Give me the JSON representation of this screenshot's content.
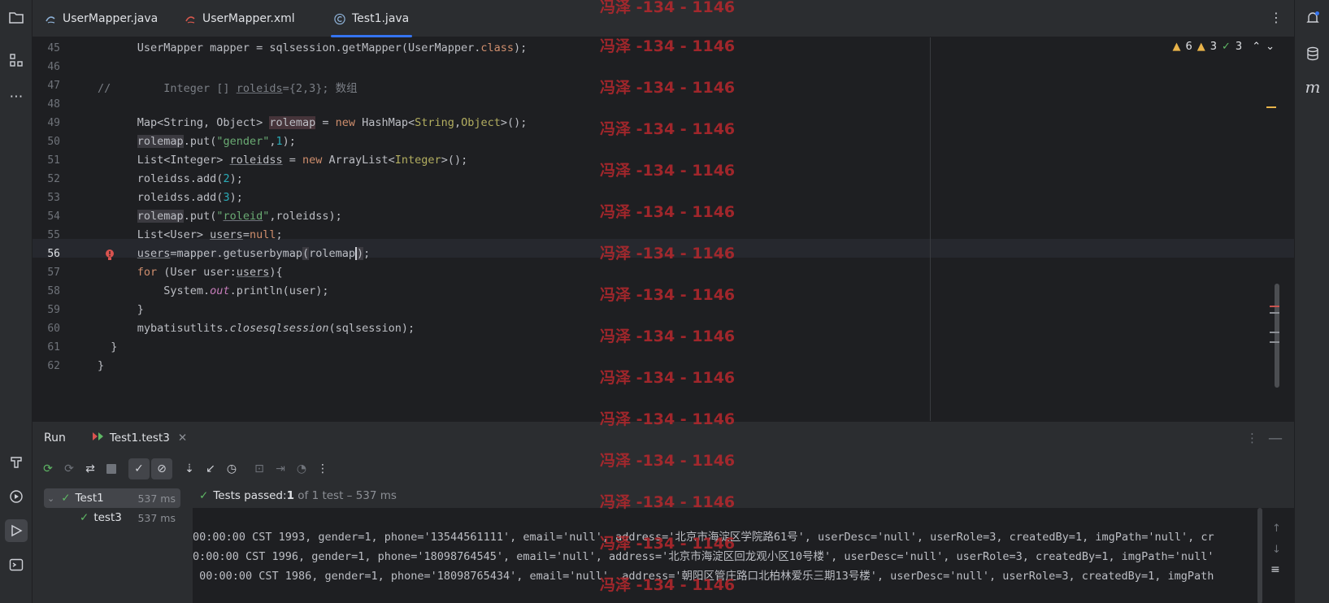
{
  "tabs": [
    {
      "label": "UserMapper.java",
      "icon": "java-interface-icon"
    },
    {
      "label": "UserMapper.xml",
      "icon": "xml-file-icon"
    },
    {
      "label": "Test1.java",
      "icon": "java-class-icon",
      "active": true
    }
  ],
  "inspections": {
    "warnings": "6",
    "weak_warnings": "3",
    "ok": "3"
  },
  "editor": {
    "line_numbers": [
      "45",
      "46",
      "47",
      "48",
      "49",
      "50",
      "51",
      "52",
      "53",
      "54",
      "55",
      "56",
      "57",
      "58",
      "59",
      "60",
      "61",
      "62"
    ],
    "current_line": "56"
  },
  "run": {
    "title": "Run",
    "config_tab": "Test1.test3",
    "tree": [
      {
        "label": "Test1",
        "time": "537 ms"
      },
      {
        "label": "test3",
        "time": "537 ms"
      }
    ],
    "status_prefix": "Tests passed: ",
    "status_count": "1",
    "status_suffix": " of 1 test – 537 ms",
    "output": [
      "00:00:00 CST 1993, gender=1, phone='13544561111', email='null', address='北京市海淀区学院路61号', userDesc='null', userRole=3, createdBy=1, imgPath='null', cr",
      "0:00:00 CST 1996, gender=1, phone='18098764545', email='null', address='北京市海淀区回龙观小区10号楼', userDesc='null', userRole=3, createdBy=1, imgPath='null'",
      " 00:00:00 CST 1986, gender=1, phone='18098765434', email='null', address='朝阳区管庄路口北柏林爱乐三期13号楼', userDesc='null', userRole=3, createdBy=1, imgPath"
    ]
  },
  "watermark": "冯泽 -134 - 1146",
  "colors": {
    "accent": "#3574f0",
    "pass": "#5fb865",
    "warning": "#e8b34a",
    "watermark": "#b3282d"
  }
}
